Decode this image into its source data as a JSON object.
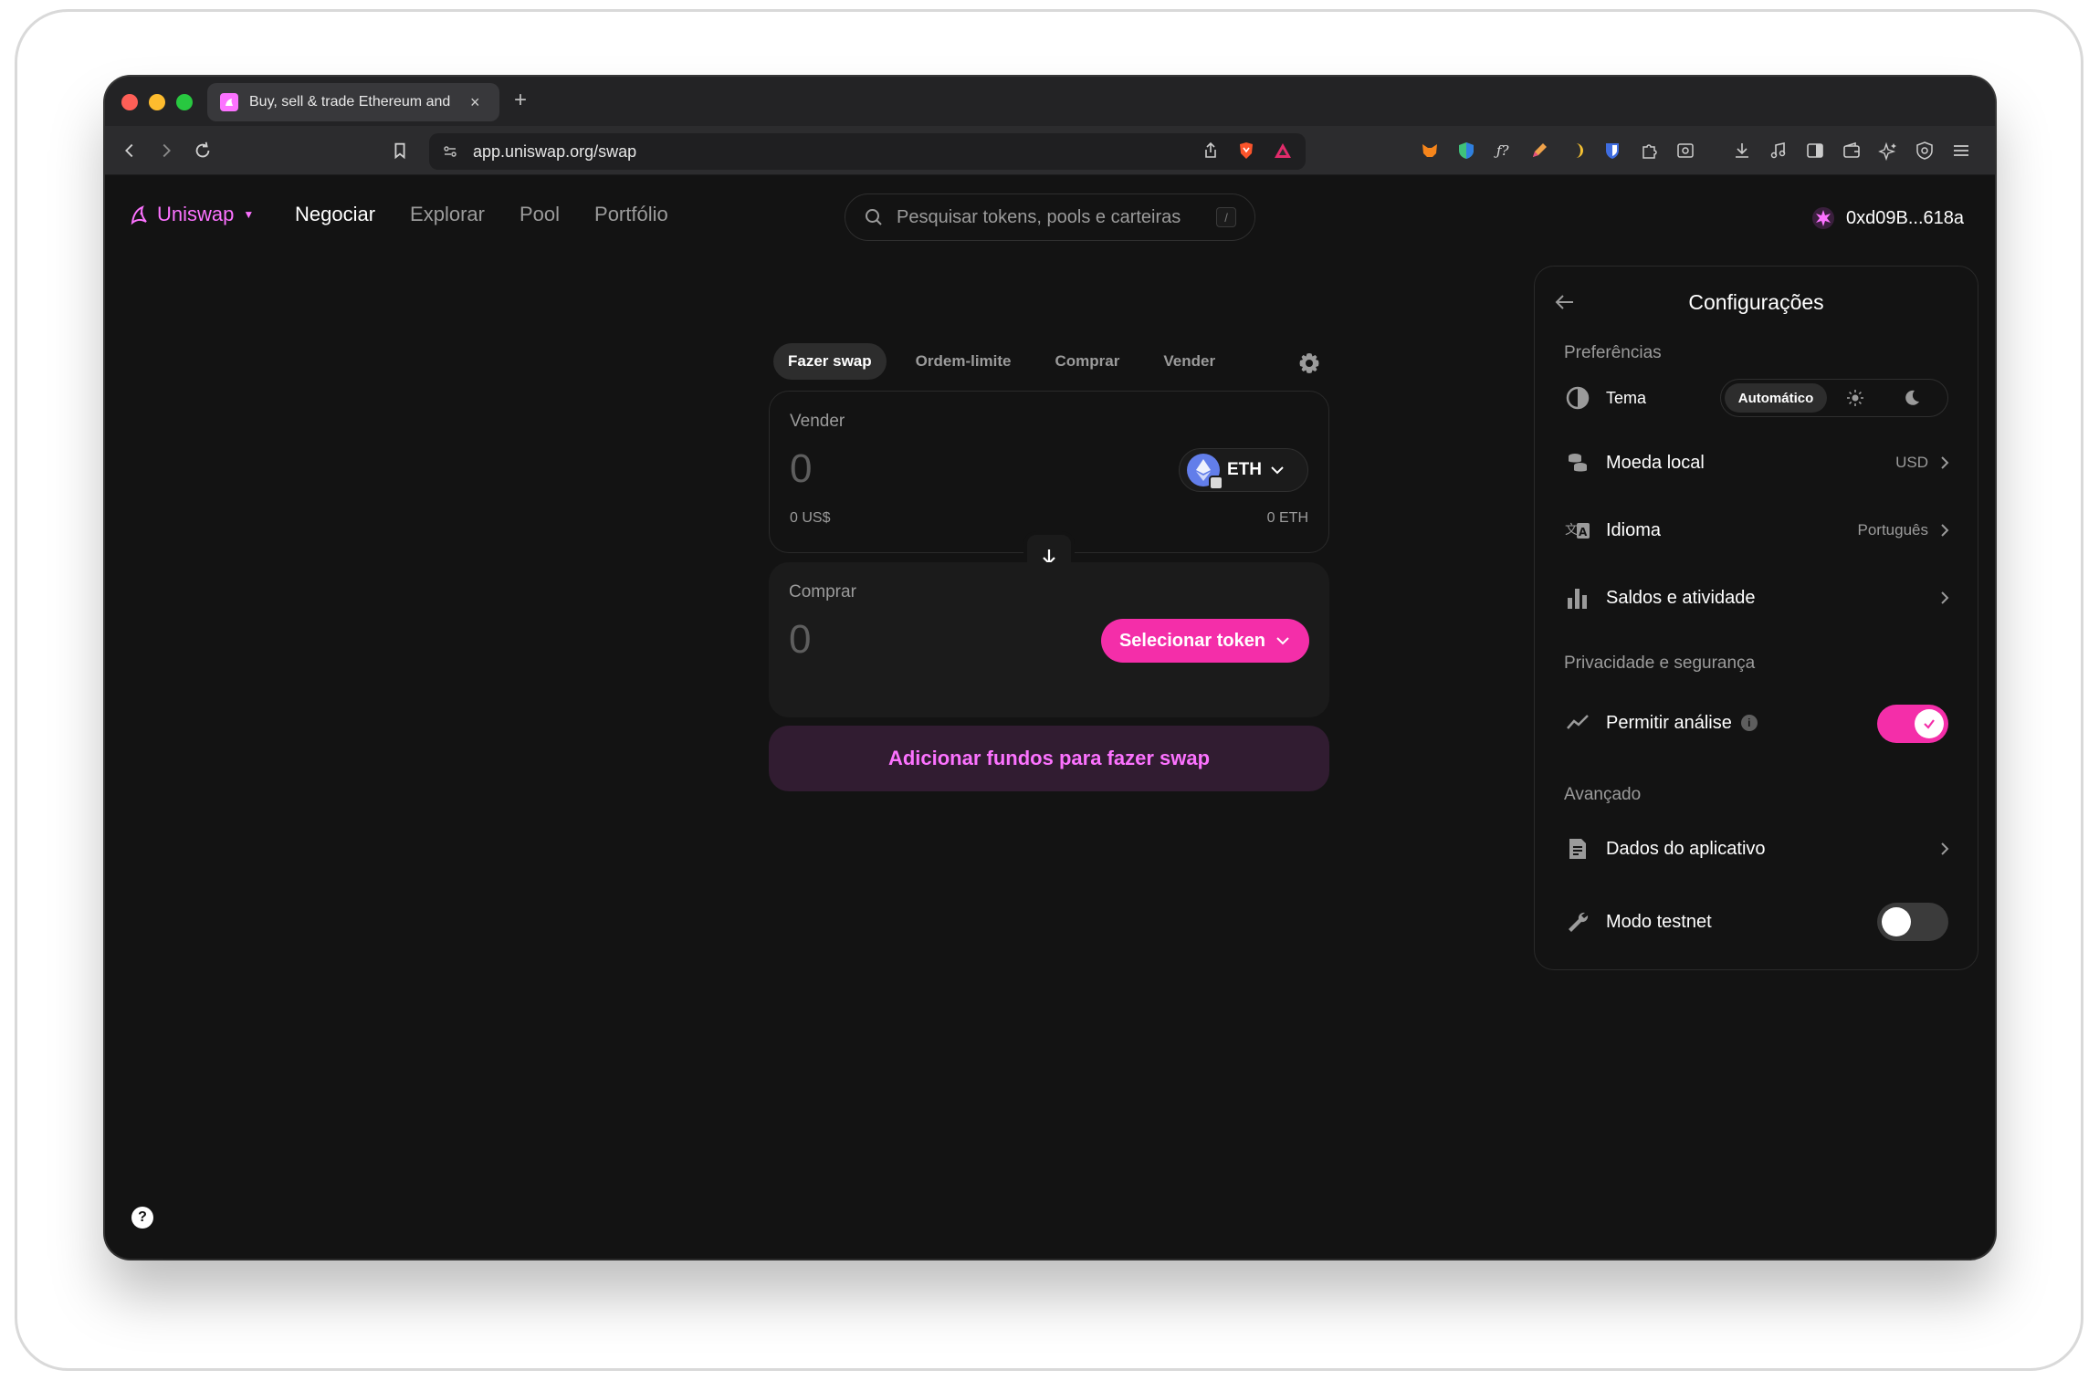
{
  "browser": {
    "tab_title": "Buy, sell & trade Ethereum and",
    "new_tab": "+",
    "close_tab": "×",
    "url": "app.uniswap.org/swap"
  },
  "header": {
    "logo": "Uniswap",
    "nav": [
      "Negociar",
      "Explorar",
      "Pool",
      "Portfólio"
    ],
    "search_placeholder": "Pesquisar tokens, pools e carteiras",
    "search_shortcut": "/",
    "account": "0xd09B...618a"
  },
  "swap": {
    "tabs": [
      "Fazer swap",
      "Ordem-limite",
      "Comprar",
      "Vender"
    ],
    "sell": {
      "label": "Vender",
      "amount": "0",
      "usd": "0 US$",
      "balance": "0 ETH",
      "token": "ETH"
    },
    "buy": {
      "label": "Comprar",
      "amount": "0",
      "select_label": "Selecionar token"
    },
    "cta": "Adicionar fundos para fazer swap"
  },
  "settings": {
    "title": "Configurações",
    "preferences_title": "Preferências",
    "theme_label": "Tema",
    "theme_selected": "Automático",
    "currency_label": "Moeda local",
    "currency_value": "USD",
    "language_label": "Idioma",
    "language_value": "Português",
    "balances_label": "Saldos e atividade",
    "privacy_title": "Privacidade e segurança",
    "analytics_label": "Permitir análise",
    "analytics_on": true,
    "advanced_title": "Avançado",
    "appdata_label": "Dados do aplicativo",
    "testnet_label": "Modo testnet",
    "testnet_on": false
  },
  "help": "?",
  "colors": {
    "accent": "#fc72ff",
    "accent_strong": "#f42ea9",
    "background": "#131313"
  }
}
